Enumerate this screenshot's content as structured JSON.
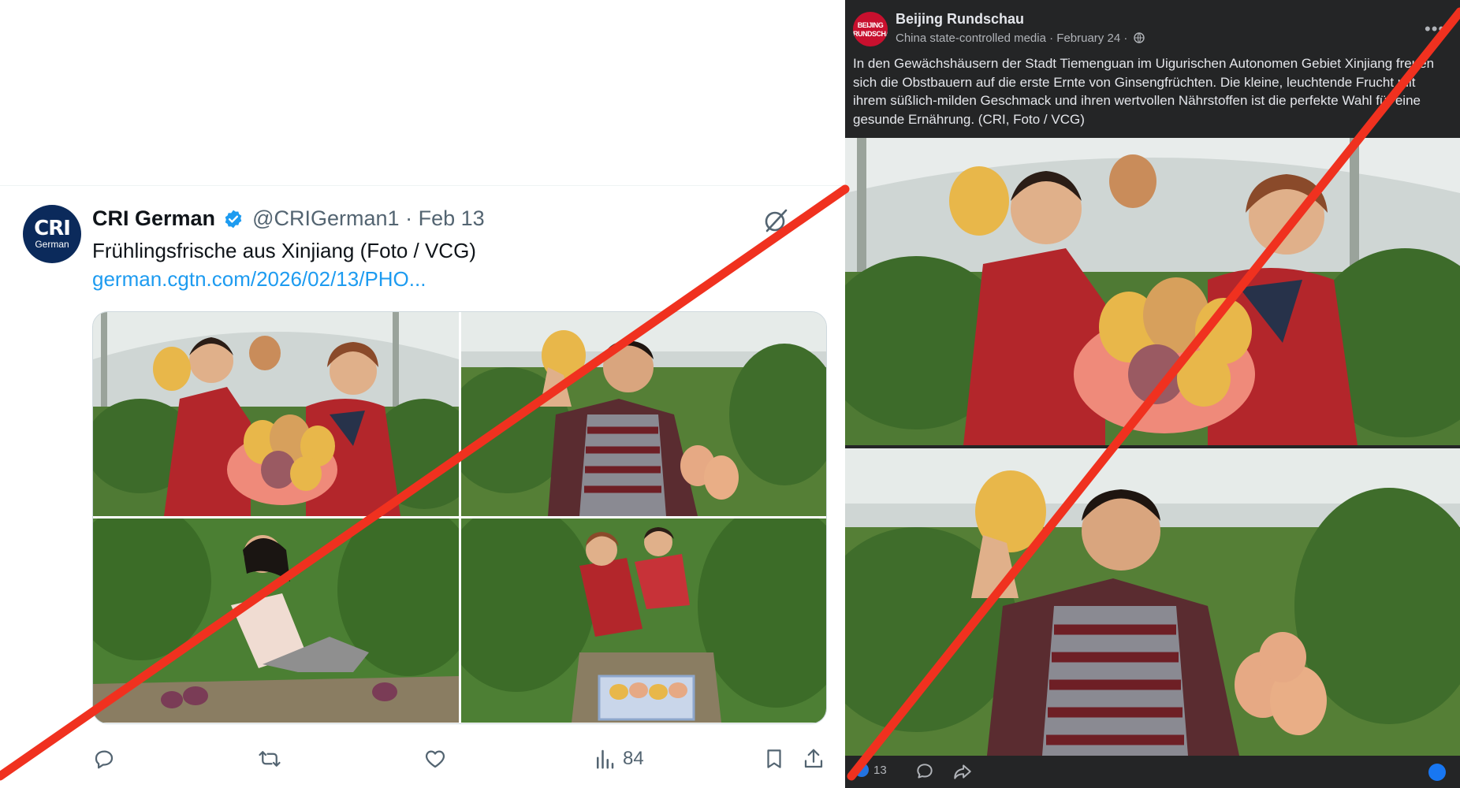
{
  "tweet": {
    "author_name": "CRI German",
    "handle": "@CRIGerman1",
    "separator": "·",
    "date": "Feb 13",
    "text": "Frühlingsfrische aus Xinjiang (Foto / VCG)",
    "link": "german.cgtn.com/2026/02/13/PHO...",
    "avatar_logo": "CRI",
    "avatar_sub": "German",
    "views": "84",
    "icons": [
      "verified-icon",
      "grok-icon",
      "reply-icon",
      "retweet-icon",
      "like-icon",
      "views-icon",
      "bookmark-icon",
      "share-icon"
    ]
  },
  "facebook": {
    "page_name": "Beijing Rundschau",
    "label": "China state-controlled media",
    "date": "February 24",
    "avatar_logo": "BEIJING RUNDSCHAU",
    "text": "In den Gewächshäusern der Stadt Tiemenguan im Uigurischen Autonomen Gebiet Xinjiang freuen sich die Obstbauern auf die erste Ernte von Ginsengfrüchten. Die kleine, leuchtende Frucht mit ihrem süßlich-milden Geschmack und ihren wertvollen Nährstoffen ist die perfekte Wahl für eine gesunde Ernährung. (CRI, Foto / VCG)",
    "reaction_count": "13",
    "icons": [
      "globe-icon",
      "more-icon",
      "comment-icon",
      "share-icon",
      "like-icon"
    ]
  },
  "colors": {
    "strike_red": "#f0311f",
    "twitter_blue": "#1d9bf0",
    "facebook_dark": "#242526",
    "melon_yellow": "#e8b74a",
    "melon_purple": "#7a3c56"
  }
}
